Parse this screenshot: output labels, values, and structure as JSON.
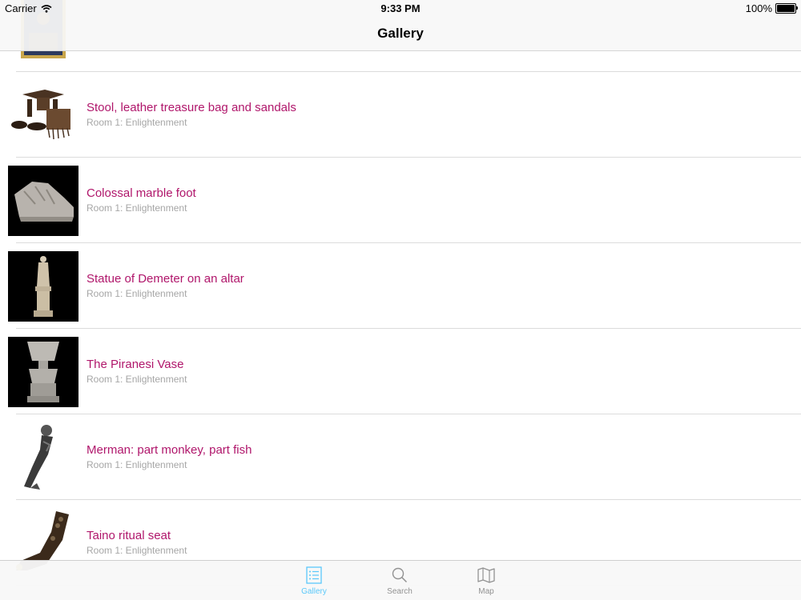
{
  "status_bar": {
    "carrier": "Carrier",
    "time": "9:33 PM",
    "battery": "100%",
    "battery_level": 1.0
  },
  "nav": {
    "title": "Gallery"
  },
  "items": [
    {
      "title": "",
      "subtitle": "",
      "thumb": "painting-thumbnail"
    },
    {
      "title": "Stool, leather treasure bag and sandals",
      "subtitle": "Room 1: Enlightenment",
      "thumb": "stool-thumbnail"
    },
    {
      "title": "Colossal marble foot",
      "subtitle": "Room 1: Enlightenment",
      "thumb": "marble-foot-thumbnail"
    },
    {
      "title": "Statue of Demeter on an altar",
      "subtitle": "Room 1: Enlightenment",
      "thumb": "demeter-statue-thumbnail"
    },
    {
      "title": "The Piranesi Vase",
      "subtitle": "Room 1: Enlightenment",
      "thumb": "piranesi-vase-thumbnail"
    },
    {
      "title": "Merman: part monkey, part fish",
      "subtitle": "Room 1: Enlightenment",
      "thumb": "merman-thumbnail"
    },
    {
      "title": "Taino ritual seat",
      "subtitle": "Room 1: Enlightenment",
      "thumb": "taino-seat-thumbnail"
    }
  ],
  "tabs": [
    {
      "label": "Gallery",
      "icon": "list-icon",
      "active": true
    },
    {
      "label": "Search",
      "icon": "search-icon",
      "active": false
    },
    {
      "label": "Map",
      "icon": "map-icon",
      "active": false
    }
  ],
  "colors": {
    "title": "#b0166b",
    "subtitle": "#a6a6a6",
    "active_tab": "#5ac8fa",
    "inactive_tab": "#929292"
  }
}
